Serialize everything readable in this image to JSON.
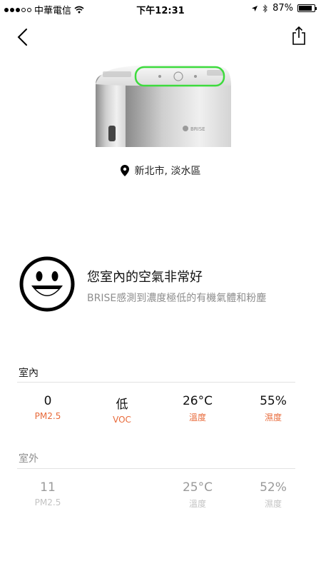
{
  "status_bar": {
    "carrier": "中華電信",
    "time": "下午12:31",
    "battery": "87%",
    "battery_level": 0.87
  },
  "location": "新北市, 淡水區",
  "air_status": {
    "title": "您室內的空氣非常好",
    "subtitle": "BRISE感測到濃度極低的有機氣體和粉塵"
  },
  "device_logo": "BRISE",
  "indoor": {
    "label": "室內",
    "metrics": [
      {
        "value": "0",
        "label": "PM2.5"
      },
      {
        "value": "低",
        "label": "VOC"
      },
      {
        "value": "26°C",
        "label": "溫度"
      },
      {
        "value": "55%",
        "label": "濕度"
      }
    ]
  },
  "outdoor": {
    "label": "室外",
    "metrics": [
      {
        "value": "11",
        "label": "PM2.5"
      },
      {
        "value": "25°C",
        "label": "溫度"
      },
      {
        "value": "52%",
        "label": "濕度"
      }
    ]
  },
  "colors": {
    "accent": "#e86a3a",
    "device_glow": "#3ddb3d"
  },
  "icons": [
    "back-chevron-icon",
    "share-icon",
    "location-pin-icon",
    "smiley-face-icon",
    "wifi-icon",
    "location-arrow-icon",
    "bluetooth-icon",
    "battery-icon"
  ]
}
